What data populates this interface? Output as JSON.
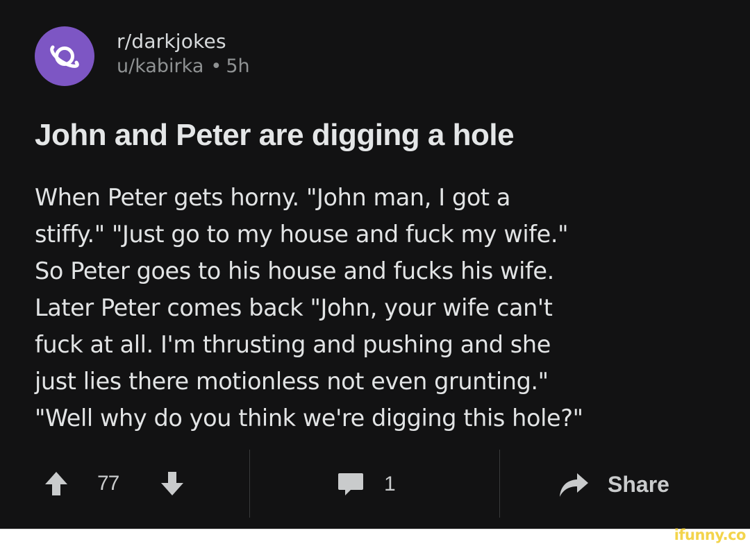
{
  "post": {
    "subreddit": "r/darkjokes",
    "username": "u/kabirka",
    "separator": "•",
    "age": "5h",
    "title": "John and Peter are digging a hole",
    "body_lines": [
      "When Peter gets horny. \"John man, I got a",
      "stiffy.\" \"Just go to my house and fuck my wife.\"",
      "So Peter goes to his house and fucks his wife.",
      "Later Peter comes back \"John, your wife can't",
      "fuck at all. I'm thrusting and pushing and she",
      "just lies there motionless not even grunting.\"",
      "\"Well why do you think we're digging this hole?\""
    ],
    "avatar_icon": "planet-icon",
    "avatar_color": "#7d56c4"
  },
  "actions": {
    "upvote_icon": "arrow-up-icon",
    "score": "77",
    "downvote_icon": "arrow-down-icon",
    "comment_icon": "speech-bubble-icon",
    "comment_count": "1",
    "share_icon": "share-arrow-icon",
    "share_label": "Share"
  },
  "watermark": "ifunny.co",
  "colors": {
    "background": "#121213",
    "text": "#e2e4e5",
    "muted": "#8f9293",
    "watermark": "#f3d44b"
  }
}
